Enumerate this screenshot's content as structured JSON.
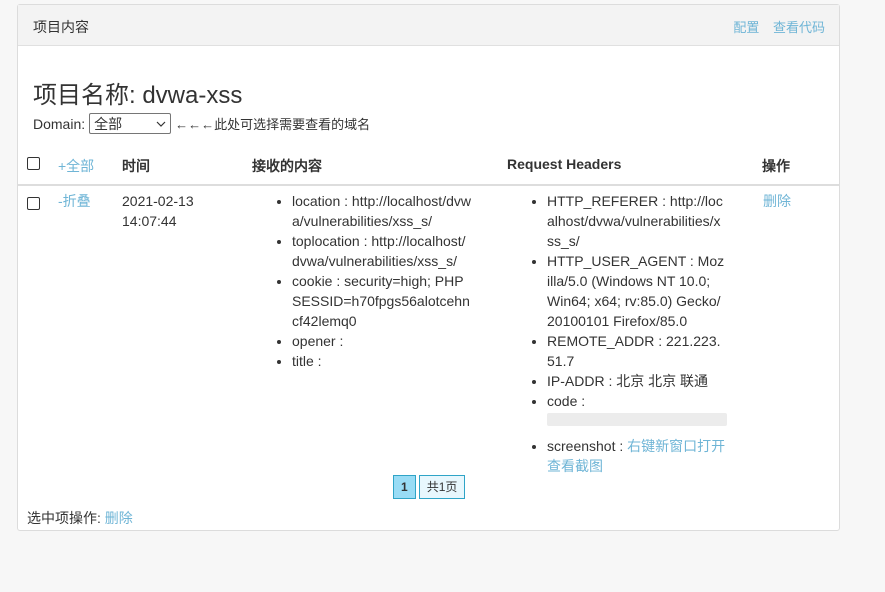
{
  "header": {
    "title": "项目内容",
    "links": [
      "配置",
      "查看代码"
    ]
  },
  "project": {
    "name": "项目名称: dvwa-xss"
  },
  "domain": {
    "label": "Domain:",
    "selected": "全部",
    "hint": "←←←此处可选择需要查看的域名"
  },
  "table": {
    "headers": {
      "toggle_all": "+全部",
      "time": "时间",
      "content": "接收的内容",
      "request_headers": "Request Headers",
      "actions": "操作"
    },
    "rows": [
      {
        "toggle": "-折叠",
        "time_date": "2021-02-13",
        "time_clock": "14:07:44",
        "content": [
          "location : http://localhost/dvwa/vulnerabilities/xss_s/",
          "toplocation : http://localhost/dvwa/vulnerabilities/xss_s/",
          "cookie : security=high; PHPSESSID=h70fpgs56alotcehncf42lemq0",
          "opener :",
          "title :"
        ],
        "headers": {
          "http_referer": "HTTP_REFERER : http://localhost/dvwa/vulnerabilities/xss_s/",
          "user_agent": "HTTP_USER_AGENT : Mozilla/5.0 (Windows NT 10.0; Win64; x64; rv:85.0) Gecko/20100101 Firefox/85.0",
          "remote_addr": "REMOTE_ADDR : 221.223.51.7",
          "ip_addr": "IP-ADDR : 北京 北京 联通",
          "code": "code :",
          "screenshot_label": "screenshot :",
          "screenshot_link": "右键新窗口打开查看截图"
        },
        "delete": "删除"
      }
    ]
  },
  "pager": {
    "current": "1",
    "total": "共1页"
  },
  "footer": {
    "label": "选中项操作:",
    "delete": "删除"
  },
  "colors": {
    "link": "#6fb5d6",
    "pager_border": "#2fa4c7",
    "pager_active": "#99dcf5"
  }
}
